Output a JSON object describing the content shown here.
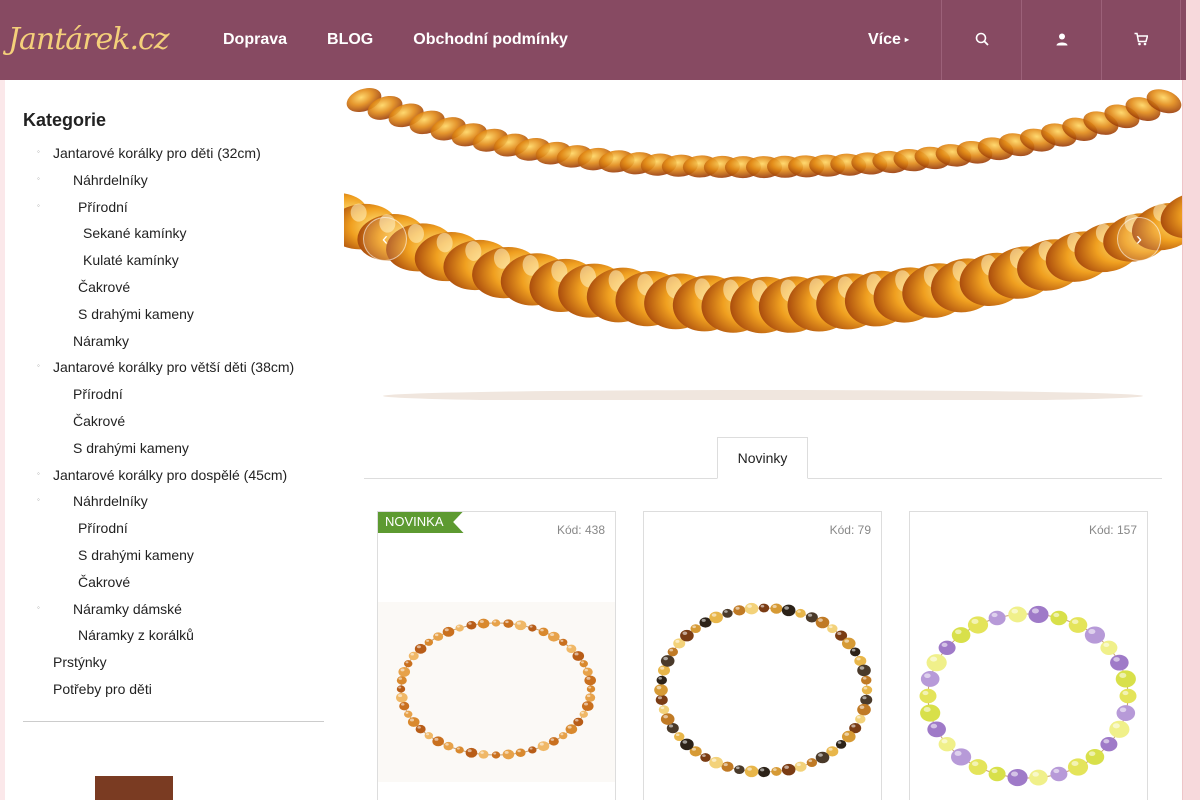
{
  "brand": {
    "logo_text": "Jantárek.cz",
    "accent": "#874a62",
    "logo_color": "#f4d07a"
  },
  "nav": {
    "items": [
      {
        "label": "Doprava"
      },
      {
        "label": "BLOG"
      },
      {
        "label": "Obchodní podmínky"
      }
    ],
    "more_label": "Více",
    "buttons": [
      {
        "icon": "search-icon"
      },
      {
        "icon": "user-icon"
      },
      {
        "icon": "cart-icon"
      }
    ]
  },
  "sidebar": {
    "title": "Kategorie",
    "items": [
      {
        "label": "Jantarové korálky pro děti (32cm)",
        "level": 0,
        "bullet": true
      },
      {
        "label": "Náhrdelníky",
        "level": 1,
        "bullet": true
      },
      {
        "label": "Přírodní",
        "level": 2,
        "bullet": true
      },
      {
        "label": "Sekané kamínky",
        "level": 3,
        "bullet": false
      },
      {
        "label": "Kulaté kamínky",
        "level": 3,
        "bullet": false
      },
      {
        "label": "Čakrové",
        "level": 2,
        "bullet": false
      },
      {
        "label": "S drahými kameny",
        "level": 2,
        "bullet": false
      },
      {
        "label": "Náramky",
        "level": 1,
        "bullet": false
      },
      {
        "label": "Jantarové korálky pro větší děti (38cm)",
        "level": 0,
        "bullet": true
      },
      {
        "label": "Přírodní",
        "level": 1,
        "bullet": false
      },
      {
        "label": "Čakrové",
        "level": 1,
        "bullet": false
      },
      {
        "label": "S drahými kameny",
        "level": 1,
        "bullet": false
      },
      {
        "label": "Jantarové korálky pro dospělé (45cm)",
        "level": 0,
        "bullet": true
      },
      {
        "label": "Náhrdelníky",
        "level": 1,
        "bullet": true
      },
      {
        "label": "Přírodní",
        "level": 2,
        "bullet": false
      },
      {
        "label": "S drahými kameny",
        "level": 2,
        "bullet": false
      },
      {
        "label": "Čakrové",
        "level": 2,
        "bullet": false
      },
      {
        "label": "Náramky dámské",
        "level": 1,
        "bullet": true
      },
      {
        "label": "Náramky z korálků",
        "level": 2,
        "bullet": false
      },
      {
        "label": "Prstýnky",
        "level": 0,
        "bullet": false
      },
      {
        "label": "Potřeby pro děti",
        "level": 0,
        "bullet": false
      }
    ]
  },
  "hero": {
    "arrow_left_icon": "chevron-left-icon",
    "arrow_right_icon": "chevron-right-icon"
  },
  "tabs": [
    {
      "label": "Novinky"
    }
  ],
  "products": [
    {
      "code": "Kód: 438",
      "badge": "NOVINKA",
      "image": "amber-necklace"
    },
    {
      "code": "Kód: 79",
      "badge": "",
      "image": "mixed-amber-necklace"
    },
    {
      "code": "Kód: 157",
      "badge": "",
      "image": "lemon-amethyst-bracelet"
    }
  ]
}
